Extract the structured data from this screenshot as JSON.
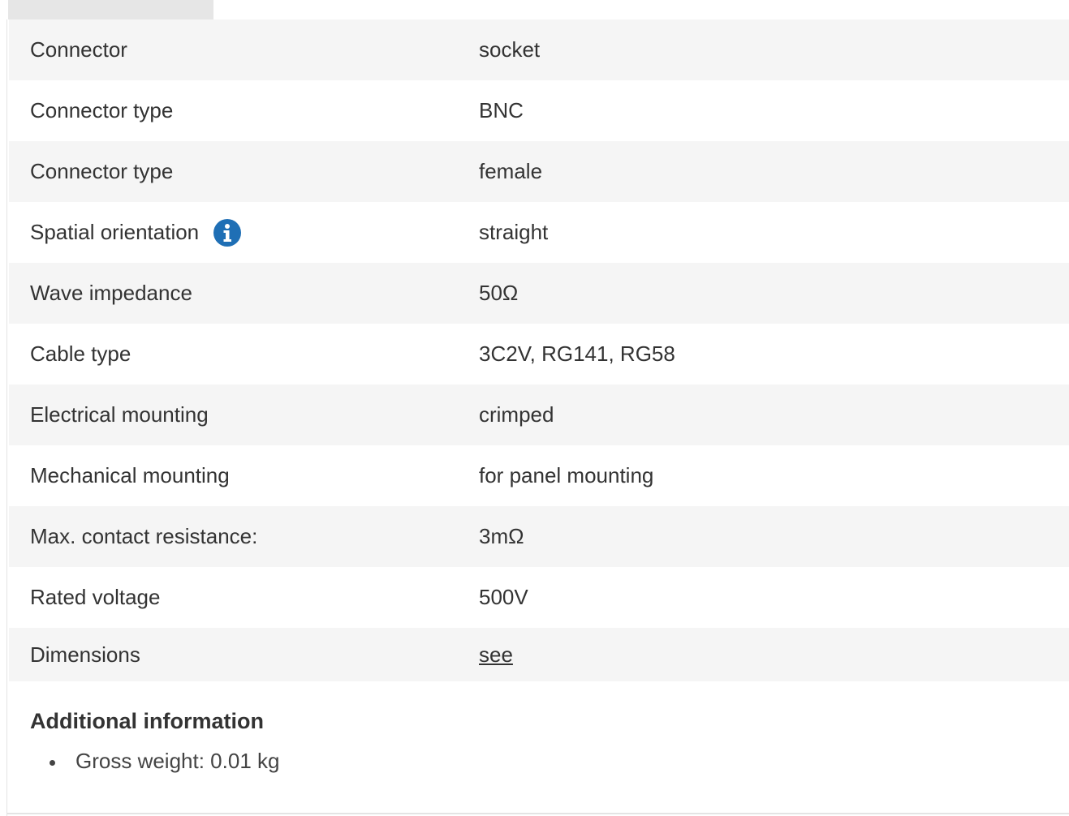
{
  "specs": {
    "rows": [
      {
        "label": "Connector",
        "value": "socket"
      },
      {
        "label": "Connector type",
        "value": "BNC"
      },
      {
        "label": "Connector type",
        "value": "female"
      },
      {
        "label": "Spatial orientation",
        "value": "straight"
      },
      {
        "label": "Wave impedance",
        "value": "50Ω"
      },
      {
        "label": "Cable type",
        "value": "3C2V, RG141, RG58"
      },
      {
        "label": "Electrical mounting",
        "value": "crimped"
      },
      {
        "label": "Mechanical mounting",
        "value": "for panel mounting"
      },
      {
        "label": "Max. contact resistance:",
        "value": "3mΩ"
      },
      {
        "label": "Rated voltage",
        "value": "500V"
      },
      {
        "label": "Dimensions",
        "value": "see"
      }
    ]
  },
  "icons": {
    "info_icon": "info-icon",
    "info_color": "#1f6fb5"
  },
  "additional": {
    "title": "Additional information",
    "items": [
      "Gross weight: 0.01 kg"
    ]
  }
}
